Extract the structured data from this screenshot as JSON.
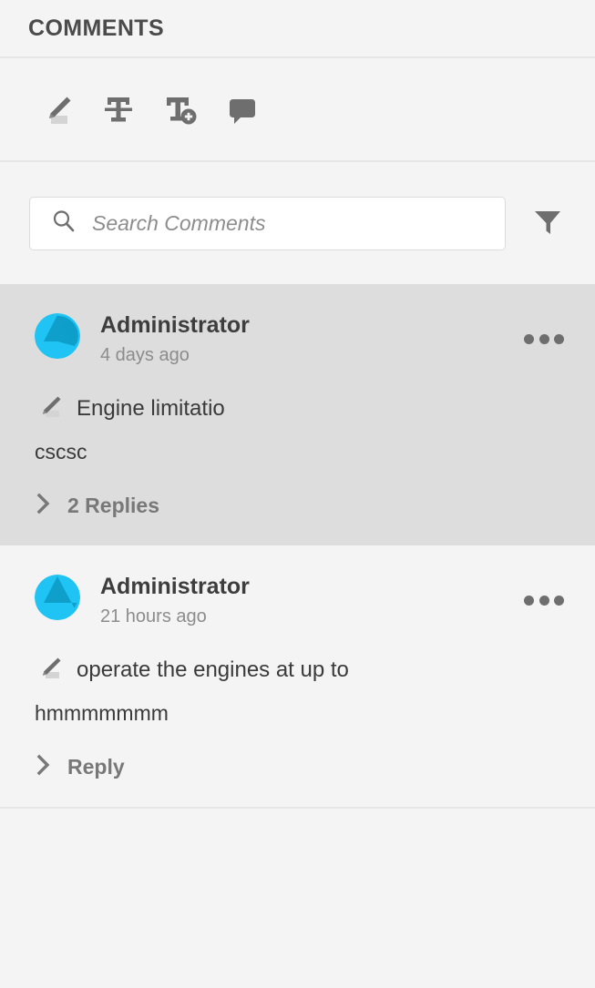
{
  "header": {
    "title": "COMMENTS"
  },
  "toolbar": {
    "tools": [
      {
        "name": "highlight-text-tool",
        "label": "Highlight Text"
      },
      {
        "name": "strikethrough-text-tool",
        "label": "Strikethrough Text"
      },
      {
        "name": "add-text-tool",
        "label": "Add Text Comment"
      },
      {
        "name": "add-note-tool",
        "label": "Add Sticky Note"
      }
    ]
  },
  "search": {
    "placeholder": "Search Comments",
    "value": "",
    "filter_label": "Filter"
  },
  "comments": [
    {
      "author": "Administrator",
      "timestamp": "4 days ago",
      "quote": "Engine limitatio",
      "body": "cscsc",
      "replies_label": "2 Replies",
      "selected": true,
      "menu_label": "More options"
    },
    {
      "author": "Administrator",
      "timestamp": "21 hours ago",
      "quote": "operate the engines at up to",
      "body": "hmmmmmmm",
      "replies_label": "Reply",
      "selected": false,
      "menu_label": "More options"
    }
  ],
  "colors": {
    "panel_bg": "#f4f4f4",
    "selected_bg": "#dddddd",
    "divider": "#e6e6e6",
    "avatar_light": "#1fc4f4",
    "avatar_dark": "#0d9fca",
    "icon": "#6e6e6e",
    "highlight_swatch": "#d4d4d4"
  }
}
